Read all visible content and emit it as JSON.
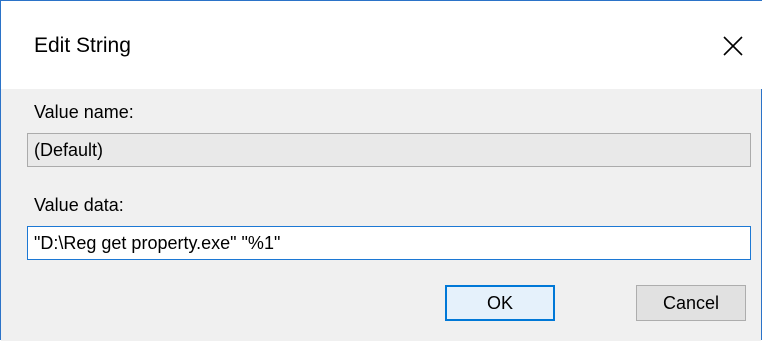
{
  "dialog": {
    "title": "Edit String",
    "close_icon": "close-icon"
  },
  "value_name": {
    "label": "Value name:",
    "value": "(Default)"
  },
  "value_data": {
    "label": "Value data:",
    "value": "\"D:\\Reg get property.exe\" \"%1\""
  },
  "buttons": {
    "ok_label": "OK",
    "cancel_label": "Cancel"
  },
  "colors": {
    "window_border": "#2b73c8",
    "focus_border": "#1c78d4",
    "default_button_border": "#0078d7"
  }
}
